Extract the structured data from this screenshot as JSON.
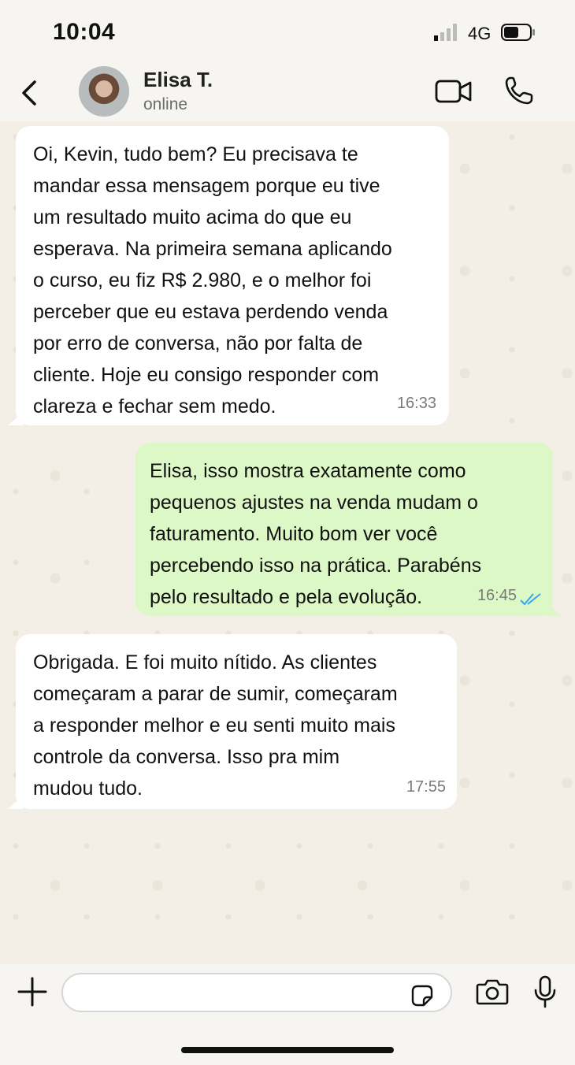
{
  "status_bar": {
    "time": "10:04",
    "network": "4G",
    "icons": [
      "signal-icon",
      "battery-icon"
    ]
  },
  "header": {
    "contact_name": "Elisa T.",
    "contact_status": "online",
    "icons": [
      "back-icon",
      "avatar",
      "video-call-icon",
      "phone-call-icon"
    ]
  },
  "messages": [
    {
      "direction": "incoming",
      "text": "Oi, Kevin, tudo bem? Eu precisava te\nmandar essa mensagem porque eu tive\num resultado muito acima do que eu\nesperava. Na primeira semana aplicando\no curso, eu fiz R$ 2.980, e o melhor foi\nperceber que eu estava perdendo venda\npor erro de conversa, não por falta de\ncliente. Hoje eu consigo responder com\nclareza e fechar sem medo.",
      "time": "16:33"
    },
    {
      "direction": "outgoing",
      "text": "Elisa, isso mostra exatamente como\npequenos ajustes na venda mudam o\nfaturamento. Muito bom ver você\npercebendo isso na prática. Parabéns\npelo resultado e pela evolução.",
      "time": "16:45",
      "read_status": "read"
    },
    {
      "direction": "incoming",
      "text": "Obrigada. E foi muito nítido. As clientes\ncomeçaram a parar de sumir, começaram\na responder melhor e eu senti muito mais\ncontrole da conversa. Isso pra mim\nmudou tudo.",
      "time": "17:55"
    }
  ],
  "input_bar": {
    "value": "",
    "placeholder": "",
    "icons": [
      "plus-icon",
      "sticker-icon",
      "camera-icon",
      "microphone-icon"
    ]
  },
  "colors": {
    "incoming_bubble": "#ffffff",
    "outgoing_bubble": "#dcf8c6",
    "chat_background": "#f3efe7",
    "read_ticks": "#34a8e8"
  }
}
